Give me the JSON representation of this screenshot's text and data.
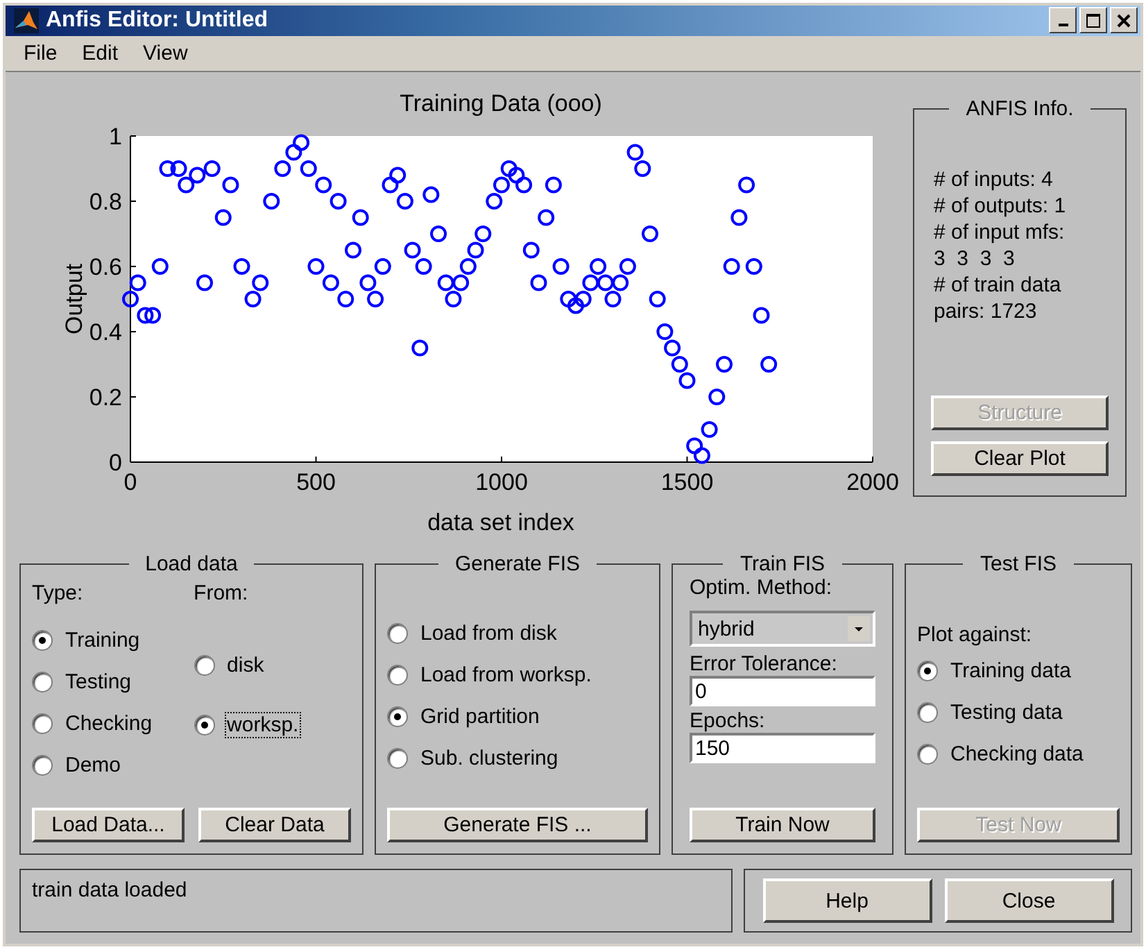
{
  "window": {
    "title": "Anfis Editor: Untitled"
  },
  "menu": [
    "File",
    "Edit",
    "View"
  ],
  "plot": {
    "chart_data": {
      "type": "scatter",
      "title": "Training Data (ooo)",
      "xlabel": "data set index",
      "ylabel": "Output",
      "xlim": [
        0,
        2000
      ],
      "ylim": [
        0,
        1
      ],
      "xticks": [
        0,
        500,
        1000,
        1500,
        2000
      ],
      "yticks": [
        0,
        0.2,
        0.4,
        0.6,
        0.8,
        1
      ],
      "x": [
        0,
        20,
        40,
        60,
        80,
        100,
        130,
        150,
        180,
        200,
        220,
        250,
        270,
        300,
        330,
        350,
        380,
        410,
        440,
        460,
        480,
        500,
        520,
        540,
        560,
        580,
        600,
        620,
        640,
        660,
        680,
        700,
        720,
        740,
        760,
        780,
        790,
        810,
        830,
        850,
        870,
        890,
        910,
        930,
        950,
        980,
        1000,
        1020,
        1040,
        1060,
        1080,
        1100,
        1120,
        1140,
        1160,
        1180,
        1200,
        1220,
        1240,
        1260,
        1280,
        1300,
        1320,
        1340,
        1360,
        1380,
        1400,
        1420,
        1440,
        1460,
        1480,
        1500,
        1520,
        1540,
        1560,
        1580,
        1600,
        1620,
        1640,
        1660,
        1680,
        1700,
        1720
      ],
      "series": [
        {
          "color": "#0000ff",
          "values": [
            0.5,
            0.55,
            0.45,
            0.45,
            0.6,
            0.9,
            0.9,
            0.85,
            0.88,
            0.55,
            0.9,
            0.75,
            0.85,
            0.6,
            0.5,
            0.55,
            0.8,
            0.9,
            0.95,
            0.98,
            0.9,
            0.6,
            0.85,
            0.55,
            0.8,
            0.5,
            0.65,
            0.75,
            0.55,
            0.5,
            0.6,
            0.85,
            0.88,
            0.8,
            0.65,
            0.35,
            0.6,
            0.82,
            0.7,
            0.55,
            0.5,
            0.55,
            0.6,
            0.65,
            0.7,
            0.8,
            0.85,
            0.9,
            0.88,
            0.85,
            0.65,
            0.55,
            0.75,
            0.85,
            0.6,
            0.5,
            0.48,
            0.5,
            0.55,
            0.6,
            0.55,
            0.5,
            0.55,
            0.6,
            0.95,
            0.9,
            0.7,
            0.5,
            0.4,
            0.35,
            0.3,
            0.25,
            0.05,
            0.02,
            0.1,
            0.2,
            0.3,
            0.6,
            0.75,
            0.85,
            0.6,
            0.45,
            0.3
          ]
        }
      ]
    }
  },
  "info": {
    "title": "ANFIS Info.",
    "lines": [
      "# of inputs: 4",
      "# of outputs: 1",
      "# of input mfs:",
      "3  3  3  3",
      "# of train data",
      "pairs: 1723"
    ],
    "buttons": [
      {
        "label": "Structure",
        "disabled": true
      },
      {
        "label": "Clear Plot",
        "disabled": false
      }
    ]
  },
  "load_data": {
    "title": "Load data",
    "type_label": "Type:",
    "from_label": "From:",
    "types": [
      {
        "label": "Training",
        "selected": true
      },
      {
        "label": "Testing",
        "selected": false
      },
      {
        "label": "Checking",
        "selected": false
      },
      {
        "label": "Demo",
        "selected": false
      }
    ],
    "sources": [
      {
        "label": "disk",
        "selected": false,
        "focused": false
      },
      {
        "label": "worksp.",
        "selected": true,
        "focused": true
      }
    ],
    "buttons": [
      {
        "label": "Load Data...",
        "disabled": false
      },
      {
        "label": "Clear Data",
        "disabled": false
      }
    ]
  },
  "generate_fis": {
    "title": "Generate FIS",
    "options": [
      {
        "label": "Load from disk",
        "selected": false
      },
      {
        "label": "Load from worksp.",
        "selected": false
      },
      {
        "label": "Grid partition",
        "selected": true
      },
      {
        "label": "Sub. clustering",
        "selected": false
      }
    ],
    "button": {
      "label": "Generate FIS ...",
      "disabled": false
    }
  },
  "train_fis": {
    "title": "Train FIS",
    "method_label": "Optim. Method:",
    "method": "hybrid",
    "tolerance_label": "Error Tolerance:",
    "tolerance": "0",
    "epochs_label": "Epochs:",
    "epochs": "150",
    "button": {
      "label": "Train Now",
      "disabled": false
    }
  },
  "test_fis": {
    "title": "Test FIS",
    "plot_against_label": "Plot against:",
    "options": [
      {
        "label": "Training data",
        "selected": true
      },
      {
        "label": "Testing data",
        "selected": false
      },
      {
        "label": "Checking data",
        "selected": false
      }
    ],
    "button": {
      "label": "Test Now",
      "disabled": true
    }
  },
  "status": {
    "message": "train data loaded"
  },
  "footer_buttons": [
    {
      "label": "Help",
      "disabled": false
    },
    {
      "label": "Close",
      "disabled": false
    }
  ]
}
